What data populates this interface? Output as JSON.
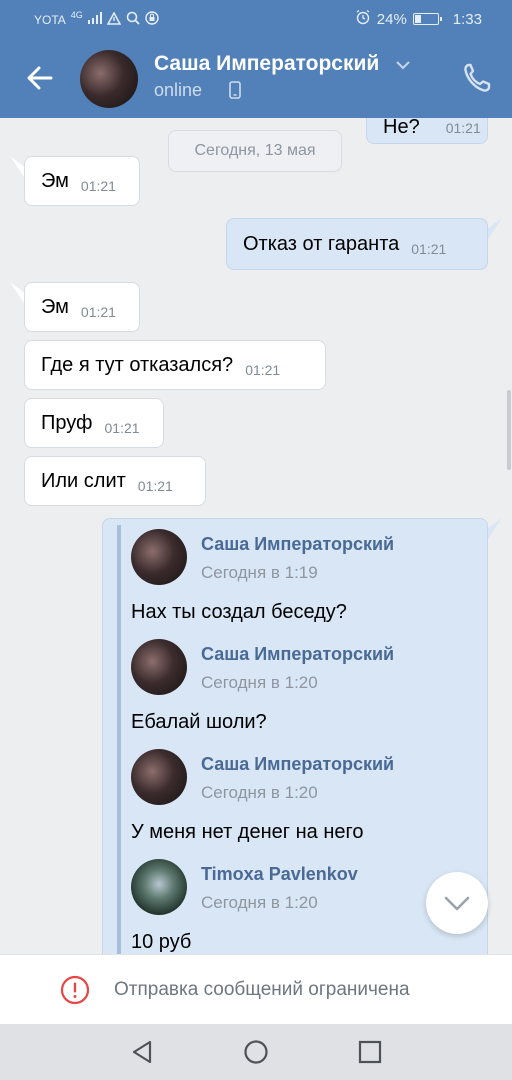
{
  "status_bar": {
    "carrier": "YOTA",
    "network": "4G",
    "battery": "24%",
    "battery_fraction": 0.24,
    "time": "1:33"
  },
  "toolbar": {
    "contact_name": "Саша Императорский",
    "contact_status": "online"
  },
  "messages": {
    "top_partial": {
      "text": "Не?",
      "time": "01:21"
    },
    "date_divider": "Сегодня, 13 мая",
    "items": [
      {
        "dir": "in",
        "text": "Эм",
        "time": "01:21"
      },
      {
        "dir": "out",
        "text": "Отказ от гаранта",
        "time": "01:21"
      },
      {
        "dir": "in",
        "text": "Эм",
        "time": "01:21"
      },
      {
        "dir": "in",
        "text": "Где я тут отказался?",
        "time": "01:21"
      },
      {
        "dir": "in",
        "text": "Пруф",
        "time": "01:21"
      },
      {
        "dir": "in",
        "text": "Или слит",
        "time": "01:21"
      }
    ]
  },
  "forwarded": [
    {
      "author": "Саша Императорский",
      "time": "Сегодня в 1:19",
      "text": "Нах ты создал беседу?"
    },
    {
      "author": "Саша Императорский",
      "time": "Сегодня в 1:20",
      "text": "Ебалай шоли?"
    },
    {
      "author": "Саша Императорский",
      "time": "Сегодня в 1:20",
      "text": "У меня нет денег на него"
    },
    {
      "author": "Timoxa Pavlenkov",
      "time": "Сегодня в 1:20",
      "text": "10 руб"
    }
  ],
  "restriction": {
    "text": "Отправка сообщений ограничена"
  },
  "colors": {
    "header": "#5181b8",
    "outgoing_bubble": "#d8e6f5",
    "incoming_bubble": "#ffffff",
    "warning": "#e64646",
    "forward_author": "#4a6a96"
  },
  "icons": [
    "back-arrow-icon",
    "chevron-down-icon",
    "phone-icon",
    "call-icon",
    "warning-icon",
    "chevron-down-icon",
    "nav-back-icon",
    "nav-home-icon",
    "nav-recents-icon"
  ]
}
